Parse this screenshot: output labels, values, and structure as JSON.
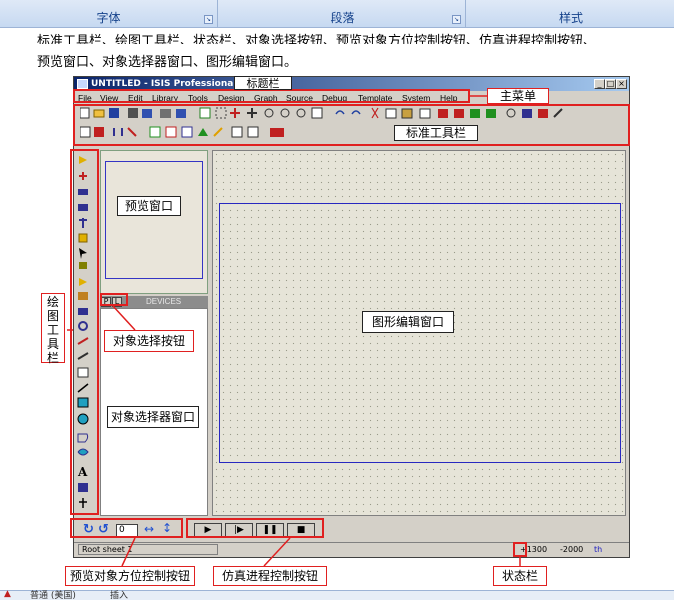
{
  "ribbon": {
    "groups": [
      "字体",
      "段落",
      "样式"
    ]
  },
  "doc": {
    "line1": "标准工具栏、绘图工具栏、状态栏、对象选择按钮、预览对象方位控制按钮、仿真进程控制按钮、",
    "line2": "预览窗口、对象选择器窗口、图形编辑窗口。"
  },
  "app": {
    "title": "UNTITLED - ISIS Professional",
    "menu": [
      "File",
      "View",
      "Edit",
      "Library",
      "Tools",
      "Design",
      "Graph",
      "Source",
      "Debug",
      "Template",
      "System",
      "Help"
    ],
    "devices_header": "DEVICES",
    "picker_buttons": [
      "P",
      "L"
    ],
    "rotate_value": "0",
    "status": {
      "sheet": "Root sheet 1",
      "x": "+1300",
      "y": "-2000",
      "unit": "th"
    }
  },
  "callouts": {
    "titlebar": "标题栏",
    "mainmenu": "主菜单",
    "std_toolbar": "标准工具栏",
    "preview_window": "预览窗口",
    "draw_toolbar": "绘图工具栏",
    "object_select_button": "对象选择按钮",
    "object_selector_window": "对象选择器窗口",
    "graph_edit_window": "图形编辑窗口",
    "preview_orient": "预览对象方位控制按钮",
    "sim_control": "仿真进程控制按钮",
    "statusbar": "状态栏"
  },
  "taskbar": {
    "left": "普通 (美国)",
    "mid": "插入"
  },
  "colors": {
    "accent_red": "#e02020",
    "title_blue": "#0a246a",
    "sheet_border": "#2828c0",
    "canvas_bg": "#e6e4d8"
  }
}
